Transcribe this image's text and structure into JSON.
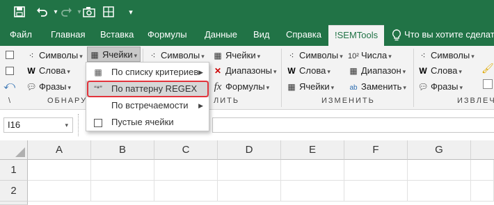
{
  "qat": {
    "save_icon": "save-icon",
    "undo_icon": "undo-icon",
    "redo_icon": "redo-icon",
    "camera_icon": "camera-icon",
    "grid_icon": "table-icon",
    "more_icon": "customize-icon"
  },
  "tabs": [
    "Файл",
    "Главная",
    "Вставка",
    "Формулы",
    "Данные",
    "Вид",
    "Справка",
    "!SEMTools"
  ],
  "tell_me": "Что вы хотите сделать?",
  "ribbon": {
    "g1": {
      "simvoly": "Символы",
      "slova": "Слова",
      "frazy": "Фразы",
      "yacheyki": "Ячейки",
      "label_part": "ОБНАРУ"
    },
    "g2": {
      "simvoly": "Символы",
      "yacheyki": "Ячейки",
      "diapazony": "Диапазоны",
      "formuly": "Формулы",
      "label_part": "ЛИТЬ"
    },
    "g3": {
      "simvoly": "Символы",
      "chisla": "Числа",
      "slova": "Слова",
      "diapazon": "Диапазон",
      "yacheyki": "Ячейки",
      "zamenit": "Заменить",
      "label": "ИЗМЕНИТЬ"
    },
    "g4": {
      "simvoly": "Символы",
      "slova": "Слова",
      "frazy": "Фразы",
      "label_part": "ИЗВЛЕЧ"
    },
    "sep_char": "\\"
  },
  "dropdown": {
    "items": [
      {
        "label": "По списку критериев",
        "has_sub": true
      },
      {
        "label": "По паттерну REGEX",
        "has_sub": false
      },
      {
        "label": "По встречаемости",
        "has_sub": true
      },
      {
        "label": "Пустые ячейки",
        "has_sub": false
      }
    ]
  },
  "namebox": "I16",
  "columns": [
    "A",
    "B",
    "C",
    "D",
    "E",
    "F",
    "G"
  ],
  "rows": [
    "1",
    "2"
  ],
  "colors": {
    "excel_green": "#217346",
    "highlight_red": "#e2333b"
  }
}
